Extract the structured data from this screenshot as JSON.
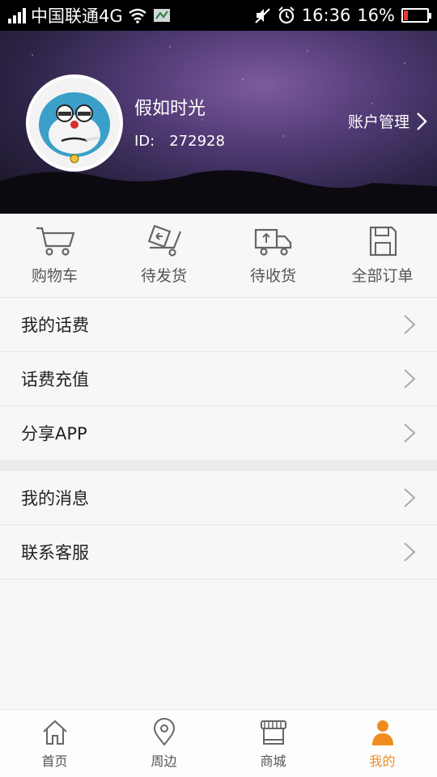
{
  "status_bar": {
    "carrier": "中国联通4G",
    "time": "16:36",
    "battery": "16%",
    "battery_level": 0.16,
    "icons": [
      "signal-icon",
      "wifi-icon",
      "notification-icon",
      "mute-icon",
      "alarm-icon",
      "battery-icon"
    ]
  },
  "profile": {
    "name": "假如时光",
    "id_label": "ID:",
    "id_value": "272928",
    "account_label": "账户管理"
  },
  "orders": [
    {
      "label": "购物车",
      "icon": "cart-icon"
    },
    {
      "label": "待发货",
      "icon": "pending-ship-icon"
    },
    {
      "label": "待收货",
      "icon": "delivery-truck-icon"
    },
    {
      "label": "全部订单",
      "icon": "all-orders-icon"
    }
  ],
  "menu_group1": [
    {
      "label": "我的话费"
    },
    {
      "label": "话费充值"
    },
    {
      "label": "分享APP"
    }
  ],
  "menu_group2": [
    {
      "label": "我的消息"
    },
    {
      "label": "联系客服"
    }
  ],
  "tabs": [
    {
      "label": "首页",
      "icon": "home-icon"
    },
    {
      "label": "周边",
      "icon": "location-pin-icon"
    },
    {
      "label": "商城",
      "icon": "store-icon"
    },
    {
      "label": "我的",
      "icon": "person-icon",
      "active": true
    }
  ],
  "colors": {
    "accent": "#f08c1e",
    "header_dark": "#2d2447",
    "battery_low": "#e53935"
  }
}
